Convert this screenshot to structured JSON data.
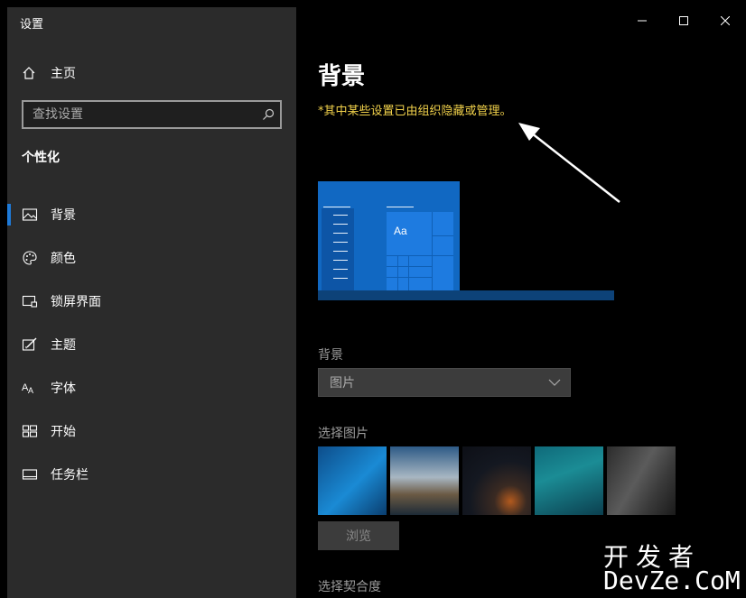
{
  "window": {
    "app_title": "设置",
    "controls": {
      "minimize": "minimize",
      "maximize": "maximize",
      "close": "close"
    }
  },
  "sidebar": {
    "home_label": "主页",
    "search_placeholder": "查找设置",
    "section_title": "个性化",
    "items": [
      {
        "label": "背景",
        "icon": "picture-icon",
        "active": true
      },
      {
        "label": "颜色",
        "icon": "palette-icon",
        "active": false
      },
      {
        "label": "锁屏界面",
        "icon": "lockscreen-icon",
        "active": false
      },
      {
        "label": "主题",
        "icon": "theme-icon",
        "active": false
      },
      {
        "label": "字体",
        "icon": "font-icon",
        "active": false
      },
      {
        "label": "开始",
        "icon": "start-icon",
        "active": false
      },
      {
        "label": "任务栏",
        "icon": "taskbar-icon",
        "active": false
      }
    ]
  },
  "main": {
    "page_title": "背景",
    "notice": "*其中某些设置已由组织隐藏或管理。",
    "notice_color": "#f2d24b",
    "preview_tile_text": "Aa",
    "background_label": "背景",
    "background_value": "图片",
    "choose_picture_label": "选择图片",
    "browse_label": "浏览",
    "choose_fit_label": "选择契合度"
  },
  "watermark": {
    "cn": "开发者",
    "en": "DevZe.CoM"
  },
  "colors": {
    "accent": "#1e7ad8",
    "sidebar_bg": "#2b2b2b",
    "content_bg": "#000000"
  }
}
